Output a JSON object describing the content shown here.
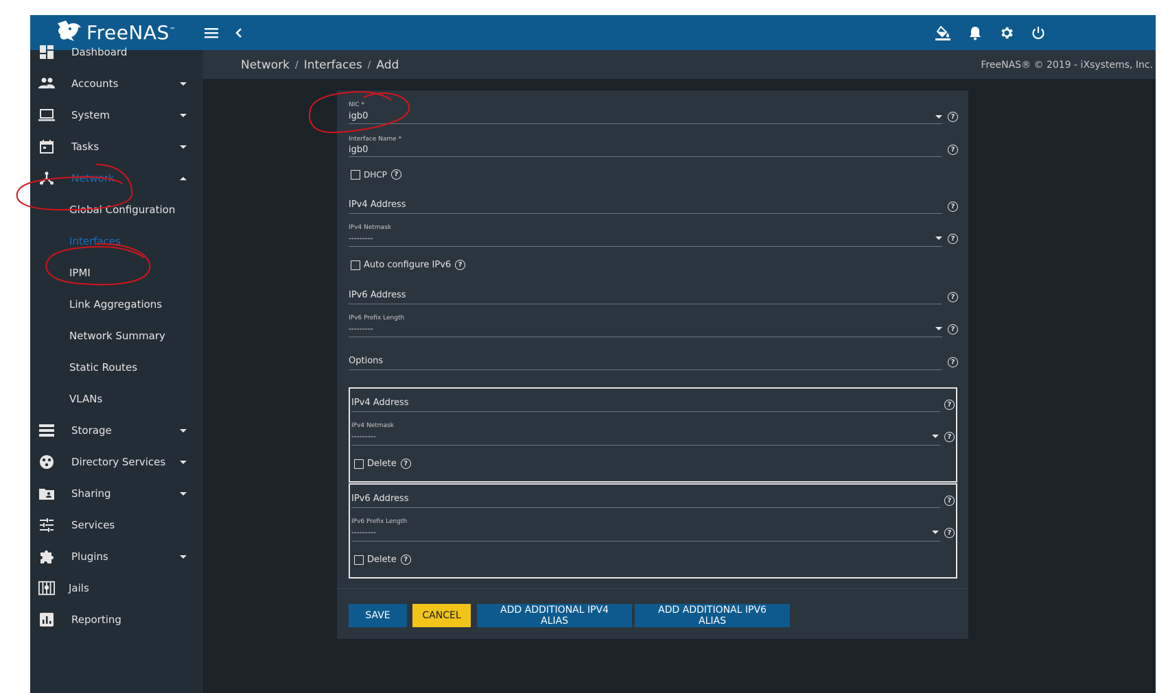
{
  "app": {
    "name": "FreeNAS",
    "trademark": "™"
  },
  "topbar": {
    "icons": [
      "menu-icon",
      "collapse-arrow-icon",
      "color-theme-icon",
      "bell-icon",
      "gear-icon",
      "power-icon"
    ]
  },
  "breadcrumb": {
    "items": [
      "Network",
      "Interfaces",
      "Add"
    ],
    "separator": "/"
  },
  "copyright": "FreeNAS® © 2019 - iXsystems, Inc.",
  "sidebar": {
    "items": [
      {
        "label": "Dashboard",
        "icon": "dashboard-icon",
        "caret": ""
      },
      {
        "label": "Accounts",
        "icon": "people-icon",
        "caret": "down"
      },
      {
        "label": "System",
        "icon": "laptop-icon",
        "caret": "down"
      },
      {
        "label": "Tasks",
        "icon": "calendar-icon",
        "caret": "down"
      },
      {
        "label": "Network",
        "icon": "network-icon",
        "caret": "up",
        "active": true
      },
      {
        "label": "Storage",
        "icon": "storage-icon",
        "caret": "down"
      },
      {
        "label": "Directory Services",
        "icon": "directory-icon",
        "caret": "down"
      },
      {
        "label": "Sharing",
        "icon": "folder-share-icon",
        "caret": "down"
      },
      {
        "label": "Services",
        "icon": "tune-icon",
        "caret": ""
      },
      {
        "label": "Plugins",
        "icon": "puzzle-icon",
        "caret": "down"
      },
      {
        "label": "Jails",
        "icon": "jail-icon",
        "caret": ""
      },
      {
        "label": "Reporting",
        "icon": "chart-icon",
        "caret": ""
      }
    ],
    "network_sub": [
      {
        "label": "Global Configuration"
      },
      {
        "label": "Interfaces",
        "active": true
      },
      {
        "label": "IPMI"
      },
      {
        "label": "Link Aggregations"
      },
      {
        "label": "Network Summary"
      },
      {
        "label": "Static Routes"
      },
      {
        "label": "VLANs"
      }
    ]
  },
  "form": {
    "nic": {
      "label": "NIC *",
      "value": "igb0"
    },
    "interface_name": {
      "label": "Interface Name *",
      "value": "igb0"
    },
    "dhcp": {
      "label": "DHCP",
      "checked": false
    },
    "ipv4_address": {
      "label": "IPv4 Address",
      "value": ""
    },
    "ipv4_netmask": {
      "label": "IPv4 Netmask",
      "value": "---------"
    },
    "auto_ipv6": {
      "label": "Auto configure IPv6",
      "checked": false
    },
    "ipv6_address": {
      "label": "IPv6 Address",
      "value": ""
    },
    "ipv6_prefix": {
      "label": "IPv6 Prefix Length",
      "value": "---------"
    },
    "options": {
      "label": "Options",
      "value": ""
    },
    "alias_v4": {
      "address_label": "IPv4 Address",
      "netmask_label": "IPv4 Netmask",
      "netmask_value": "---------",
      "delete_label": "Delete"
    },
    "alias_v6": {
      "address_label": "IPv6 Address",
      "prefix_label": "IPv6 Prefix Length",
      "prefix_value": "---------",
      "delete_label": "Delete"
    }
  },
  "buttons": {
    "save": "SAVE",
    "cancel": "CANCEL",
    "add_ipv4_alias": "ADD ADDITIONAL IPV4 ALIAS",
    "add_ipv6_alias": "ADD ADDITIONAL IPV6 ALIAS"
  },
  "colors": {
    "topbar": "#0e5a8e",
    "sidebar": "#232d36",
    "content_bg": "#1b2329",
    "card": "#2b353e",
    "primary_button": "#0e5a8e",
    "cancel_button": "#f0c419",
    "active_nav": "#1a70b8",
    "annotation": "#d4141c"
  }
}
